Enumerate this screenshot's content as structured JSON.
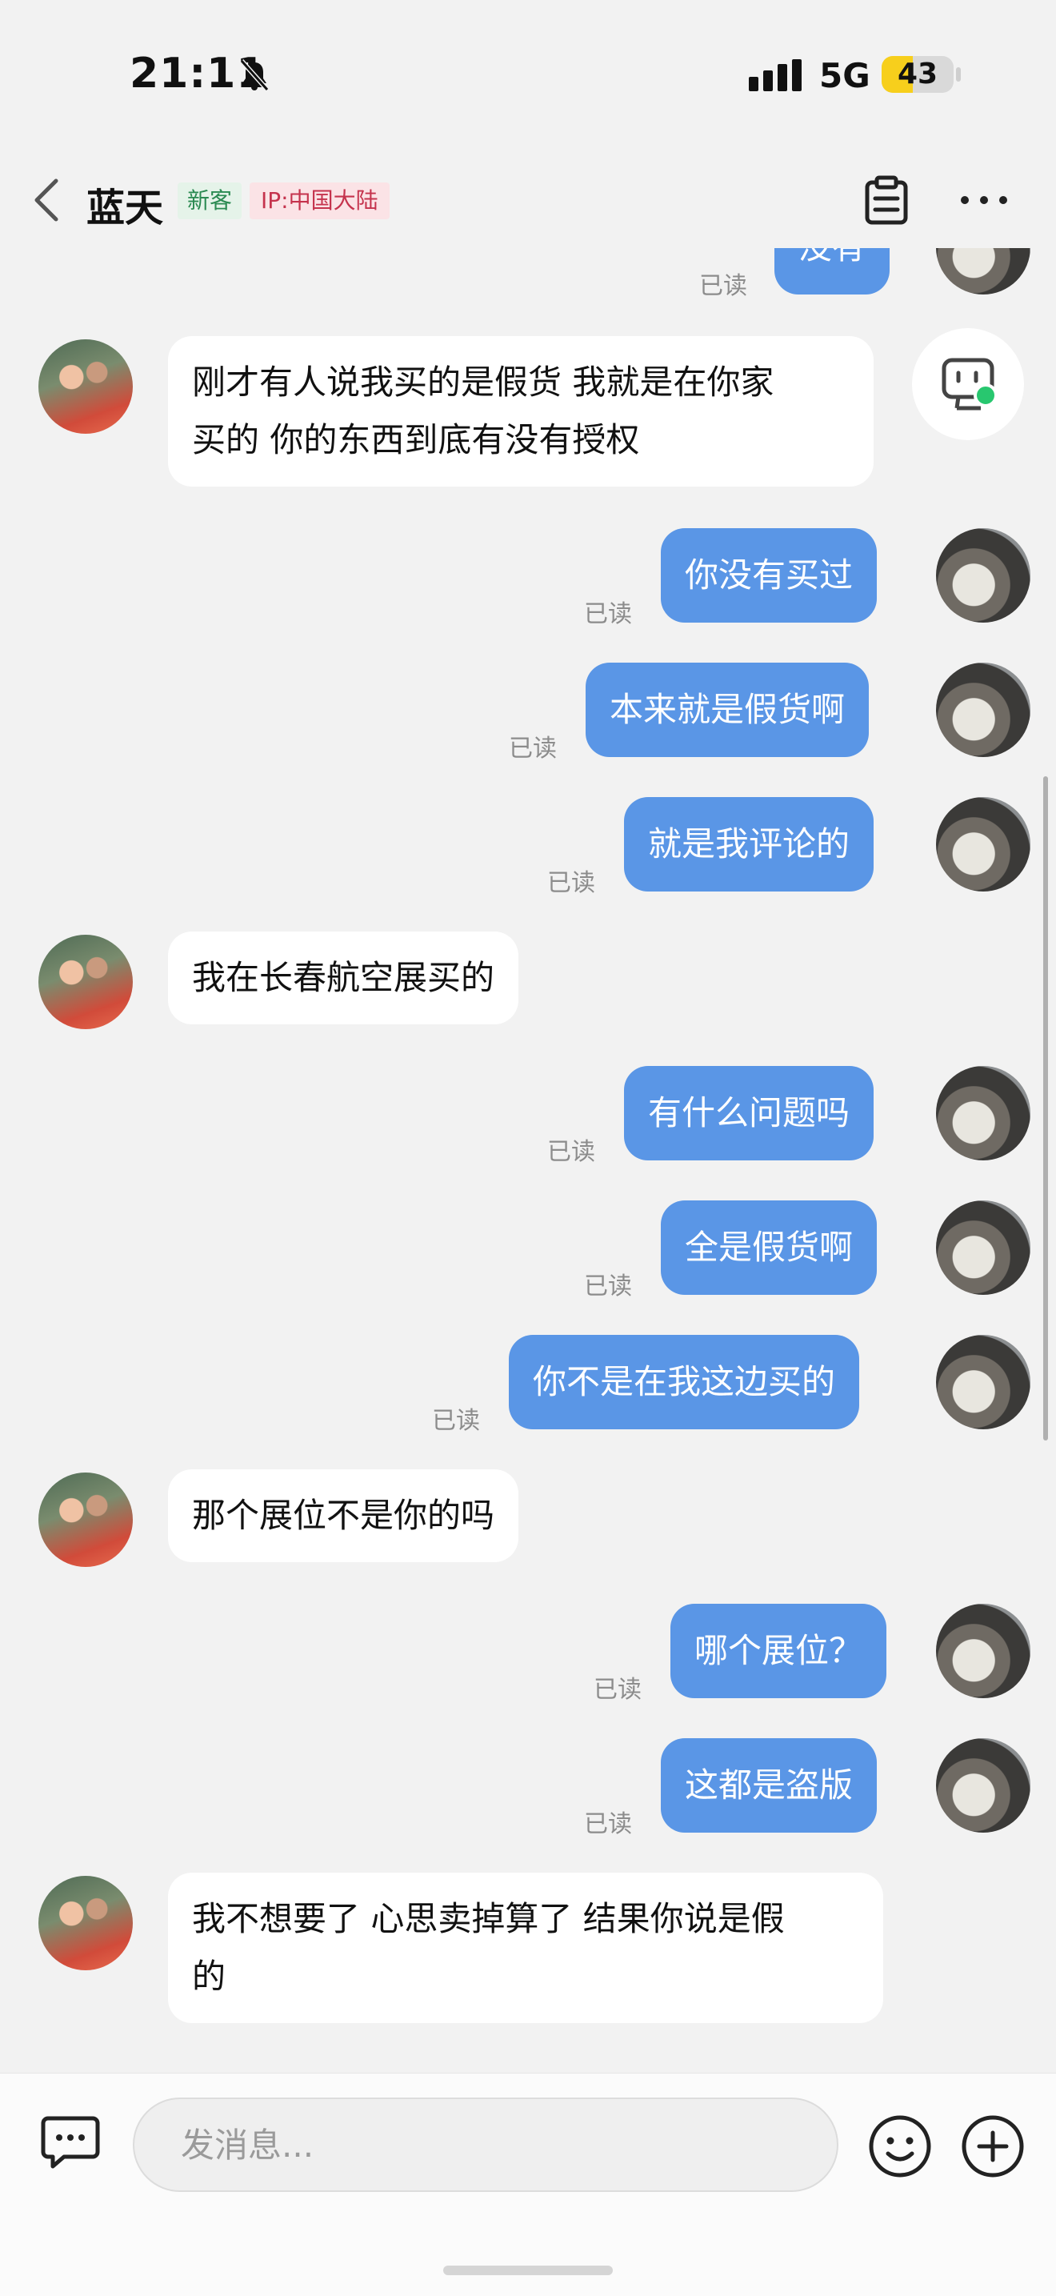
{
  "status_bar": {
    "time": "21:11",
    "network": "5G",
    "battery": "43",
    "battery_level": 0.43
  },
  "nav": {
    "name": "蓝天",
    "tag_new": "新客",
    "tag_ip": "IP:中国大陆"
  },
  "read_label": "已读",
  "messages": [
    {
      "side": "out",
      "text": "没有"
    },
    {
      "side": "in",
      "line1": "刚才有人说我买的是假货 我就是在你家",
      "line2": "买的 你的东西到底有没有授权"
    },
    {
      "side": "out",
      "text": "你没有买过"
    },
    {
      "side": "out",
      "text": "本来就是假货啊"
    },
    {
      "side": "out",
      "text": "就是我评论的"
    },
    {
      "side": "in",
      "text": "我在长春航空展买的"
    },
    {
      "side": "out",
      "text": "有什么问题吗"
    },
    {
      "side": "out",
      "text": "全是假货啊"
    },
    {
      "side": "out",
      "text": "你不是在我这边买的"
    },
    {
      "side": "in",
      "text": "那个展位不是你的吗"
    },
    {
      "side": "out",
      "text": "哪个展位？"
    },
    {
      "side": "out",
      "text": "这都是盗版"
    },
    {
      "side": "in",
      "line1": "我不想要了 心思卖掉算了 结果你说是假",
      "line2": "的"
    }
  ],
  "input": {
    "placeholder": "发消息..."
  },
  "icons": {
    "back": "chevron-left-icon",
    "clipboard": "clipboard-icon",
    "more": "more-icon",
    "keyboard": "chat-bubble-icon",
    "emoji": "emoji-icon",
    "plus": "plus-icon",
    "bot": "assistant-icon"
  },
  "colors": {
    "outgoing_bubble": "#5a96e6",
    "incoming_bubble": "#ffffff",
    "background": "#f2f2f2",
    "tag_new": "#2b8a52",
    "tag_ip": "#c5334d"
  }
}
